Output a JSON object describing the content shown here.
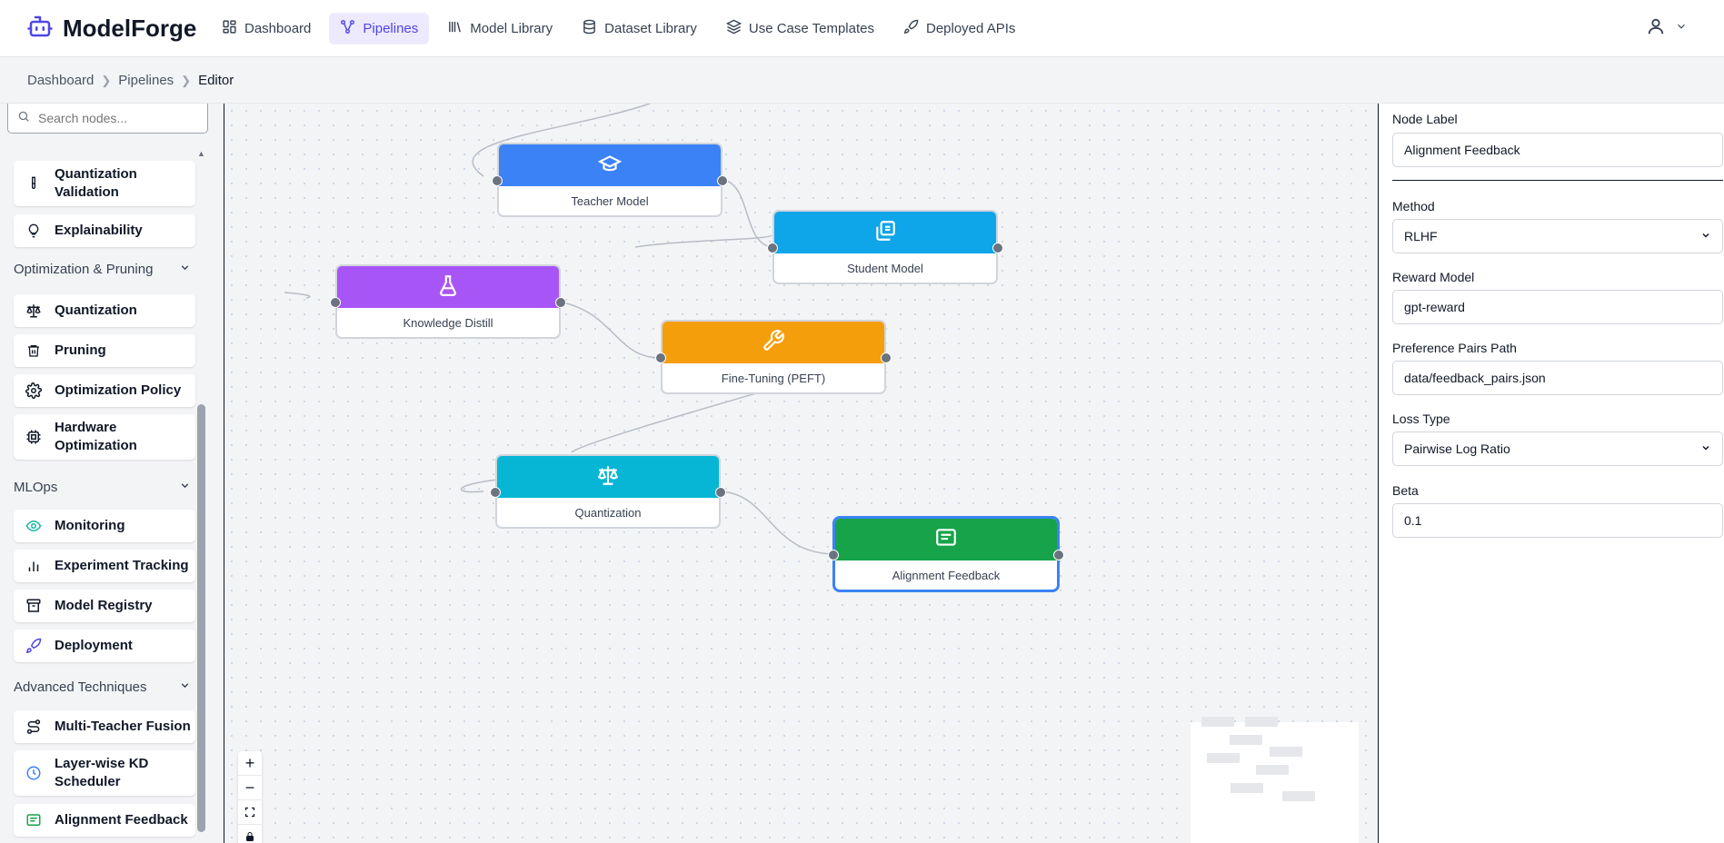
{
  "app": {
    "name": "ModelForge"
  },
  "nav": [
    {
      "label": "Dashboard",
      "icon": "grid-icon"
    },
    {
      "label": "Pipelines",
      "icon": "pipeline-icon",
      "active": true
    },
    {
      "label": "Model Library",
      "icon": "library-icon"
    },
    {
      "label": "Dataset Library",
      "icon": "database-icon"
    },
    {
      "label": "Use Case Templates",
      "icon": "layers-icon"
    },
    {
      "label": "Deployed APIs",
      "icon": "rocket-icon"
    }
  ],
  "breadcrumb": [
    "Dashboard",
    "Pipelines",
    "Editor"
  ],
  "sidebar": {
    "search_placeholder": "Search nodes...",
    "items_top": [
      {
        "label": "Quantization Validation",
        "icon": "test-tube-icon"
      },
      {
        "label": "Explainability",
        "icon": "lightbulb-icon"
      }
    ],
    "sections": [
      {
        "title": "Optimization & Pruning",
        "items": [
          {
            "label": "Quantization",
            "icon": "scale-icon"
          },
          {
            "label": "Pruning",
            "icon": "trash-icon"
          },
          {
            "label": "Optimization Policy",
            "icon": "gear-icon"
          },
          {
            "label": "Hardware Optimization",
            "icon": "chip-icon"
          }
        ]
      },
      {
        "title": "MLOps",
        "items": [
          {
            "label": "Monitoring",
            "icon": "eye-icon"
          },
          {
            "label": "Experiment Tracking",
            "icon": "bar-chart-icon"
          },
          {
            "label": "Model Registry",
            "icon": "archive-icon"
          },
          {
            "label": "Deployment",
            "icon": "rocket-icon"
          }
        ]
      },
      {
        "title": "Advanced Techniques",
        "items": [
          {
            "label": "Multi-Teacher Fusion",
            "icon": "route-icon"
          },
          {
            "label": "Layer-wise KD Scheduler",
            "icon": "clock-icon"
          },
          {
            "label": "Alignment Feedback",
            "icon": "message-icon"
          }
        ]
      }
    ]
  },
  "canvas": {
    "nodes": [
      {
        "label": "Teacher Model",
        "color": "#3b82f6",
        "icon": "graduation-cap-icon"
      },
      {
        "label": "Student Model",
        "color": "#0ea5e9",
        "icon": "copy-icon"
      },
      {
        "label": "Knowledge Distill",
        "color": "#a855f7",
        "icon": "flask-icon"
      },
      {
        "label": "Fine-Tuning (PEFT)",
        "color": "#f59e0b",
        "icon": "wrench-icon"
      },
      {
        "label": "Quantization",
        "color": "#06b6d4",
        "icon": "scale-icon"
      },
      {
        "label": "Alignment Feedback",
        "color": "#16a34a",
        "icon": "message-icon",
        "selected": true
      }
    ],
    "controls": {
      "zoom_in": "+",
      "zoom_out": "−"
    }
  },
  "properties": {
    "node_label": {
      "label": "Node Label",
      "value": "Alignment Feedback"
    },
    "method": {
      "label": "Method",
      "value": "RLHF"
    },
    "reward_model": {
      "label": "Reward Model",
      "value": "gpt-reward"
    },
    "preference_pairs_path": {
      "label": "Preference Pairs Path",
      "value": "data/feedback_pairs.json"
    },
    "loss_type": {
      "label": "Loss Type",
      "value": "Pairwise Log Ratio"
    },
    "beta": {
      "label": "Beta",
      "value": "0.1"
    }
  },
  "colors": {
    "accent": "#4f46e5",
    "selected_border": "#3b82f6"
  }
}
